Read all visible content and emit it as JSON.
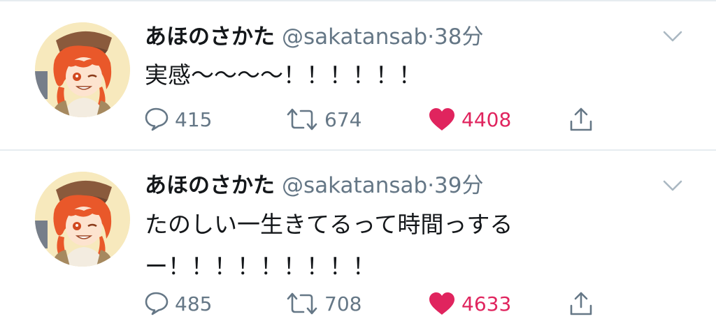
{
  "colors": {
    "text": "#14171a",
    "secondary": "#657786",
    "like": "#e0245e",
    "divider": "#e6ecf0"
  },
  "tweets": [
    {
      "display_name": "あほのさかた",
      "handle": "@sakatansab",
      "separator": "·",
      "time": "38分",
      "text_lines": [
        "実感〜〜〜〜！！！！！！"
      ],
      "replies": "415",
      "retweets": "674",
      "likes": "4408",
      "liked": true,
      "icons": {
        "reply": "reply-icon",
        "retweet": "retweet-icon",
        "like": "heart-icon",
        "share": "share-icon",
        "menu": "chevron-down-icon"
      }
    },
    {
      "display_name": "あほのさかた",
      "handle": "@sakatansab",
      "separator": "·",
      "time": "39分",
      "text_lines": [
        "たのしい一生きてるって時間っする",
        "ー！！！！！！！！！"
      ],
      "replies": "485",
      "retweets": "708",
      "likes": "4633",
      "liked": true,
      "icons": {
        "reply": "reply-icon",
        "retweet": "retweet-icon",
        "like": "heart-icon",
        "share": "share-icon",
        "menu": "chevron-down-icon"
      }
    }
  ]
}
